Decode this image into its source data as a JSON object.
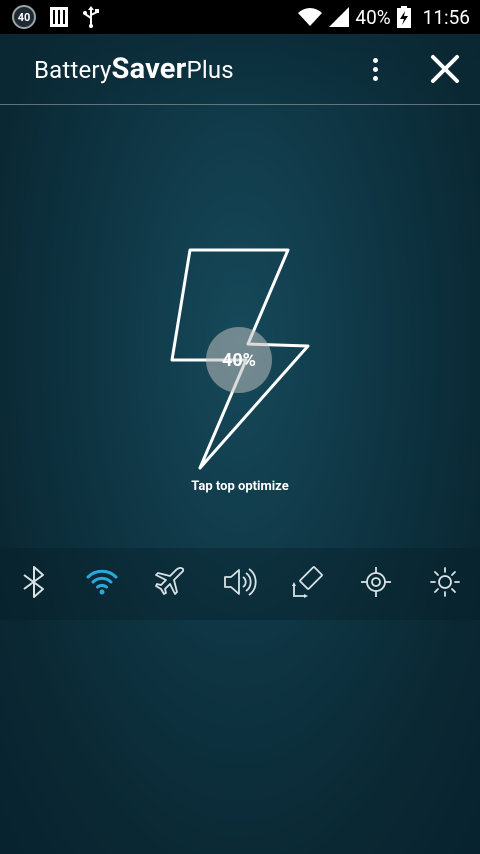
{
  "status_bar": {
    "notification_count": "40",
    "battery_percent": "40%",
    "time": "11:56",
    "icons": [
      "notification-count-icon",
      "storage-icon",
      "usb-icon",
      "wifi-icon",
      "signal-icon",
      "battery-charging-icon"
    ]
  },
  "app_bar": {
    "title_part1": "Battery",
    "title_part2": "Saver",
    "title_part3": "Plus",
    "menu_icon": "overflow-menu-icon",
    "close_icon": "close-icon"
  },
  "main": {
    "battery_level": "40%",
    "hint": "Tap top optimize",
    "bolt_icon": "lightning-bolt-icon"
  },
  "toggles": [
    {
      "name": "bluetooth",
      "icon": "bluetooth-icon",
      "active": false
    },
    {
      "name": "wifi",
      "icon": "wifi-icon",
      "active": true
    },
    {
      "name": "airplane",
      "icon": "airplane-icon",
      "active": false
    },
    {
      "name": "sound",
      "icon": "sound-icon",
      "active": false
    },
    {
      "name": "auto-rotate",
      "icon": "rotate-icon",
      "active": false
    },
    {
      "name": "gps",
      "icon": "gps-icon",
      "active": false
    },
    {
      "name": "brightness",
      "icon": "brightness-icon",
      "active": false
    }
  ],
  "colors": {
    "active_toggle": "#2aa8d8",
    "inactive_toggle": "#d8e2e6",
    "background": "#0e3442"
  }
}
